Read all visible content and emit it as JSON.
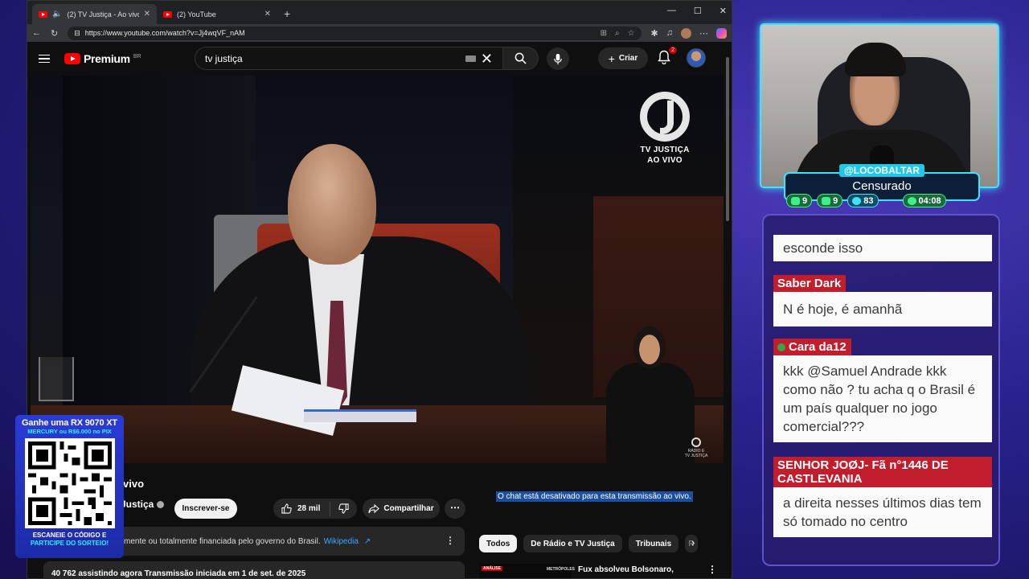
{
  "browser": {
    "tabs": [
      {
        "title": "(2) TV Justiça - Ao vivo - You",
        "active": true
      },
      {
        "title": "(2) YouTube",
        "active": false
      }
    ],
    "url": "https://www.youtube.com/watch?v=Jj4wqVF_nAM"
  },
  "youtube": {
    "logo_text": "Premium",
    "region": "BR",
    "search_value": "tv justiça",
    "create_label": "Criar",
    "notification_count": "2",
    "video": {
      "overlay_logo_line1": "TV JUSTIÇA",
      "overlay_logo_line2": "AO VIVO",
      "small_logo_line1": "RÁDIO E",
      "small_logo_line2": "TV JUSTIÇA"
    },
    "title_partial": "vivo",
    "channel_partial": "Justiça",
    "subscribe_label": "Inscrever-se",
    "likes": "28 mil",
    "share_label": "Compartilhar",
    "chat_disabled": "O chat está desativado para esta transmissão ao vivo.",
    "info_text": "mente ou totalmente financiada pelo governo do Brasil.",
    "info_link": "Wikipedia",
    "viewers_main": "40 762",
    "viewers_rest": "assistindo agora  Transmissão iniciada em 1 de set. de 2025",
    "chips": [
      "Todos",
      "De Rádio e TV Justiça",
      "Tribunais",
      "R"
    ],
    "recommendation": {
      "title": "Fux absolveu Bolsonaro,",
      "thumb_tag": "ANÁLISE",
      "thumb_brand": "METRÓPOLES"
    }
  },
  "promo": {
    "line1": "Ganhe uma RX 9070 XT",
    "line2": "MERCURY ou R$6.000 no PIX",
    "line3": "ESCANEIE O CÓDIGO E",
    "line4": "PARTICIPE DO SORTEIO!"
  },
  "stream": {
    "handle": "@LOCOBALTAR",
    "status": "Censurado",
    "stats": [
      "9",
      "9",
      "83"
    ],
    "time": "04:08",
    "accent_color": "#3de3ff"
  },
  "chat": {
    "messages": [
      {
        "user": "",
        "text": "esconde isso"
      },
      {
        "user": "Saber Dark",
        "text": "N é hoje, é amanhã"
      },
      {
        "user": "Cara da12",
        "text": "kkk @Samuel Andrade kkk como não ? tu acha q o Brasil é um país qualquer no jogo comercial???"
      },
      {
        "user": "SENHOR JOØJ- Fã n°1446 DE CASTLEVANIA",
        "text": "a direita nesses últimos dias tem só tomado no centro"
      }
    ]
  }
}
